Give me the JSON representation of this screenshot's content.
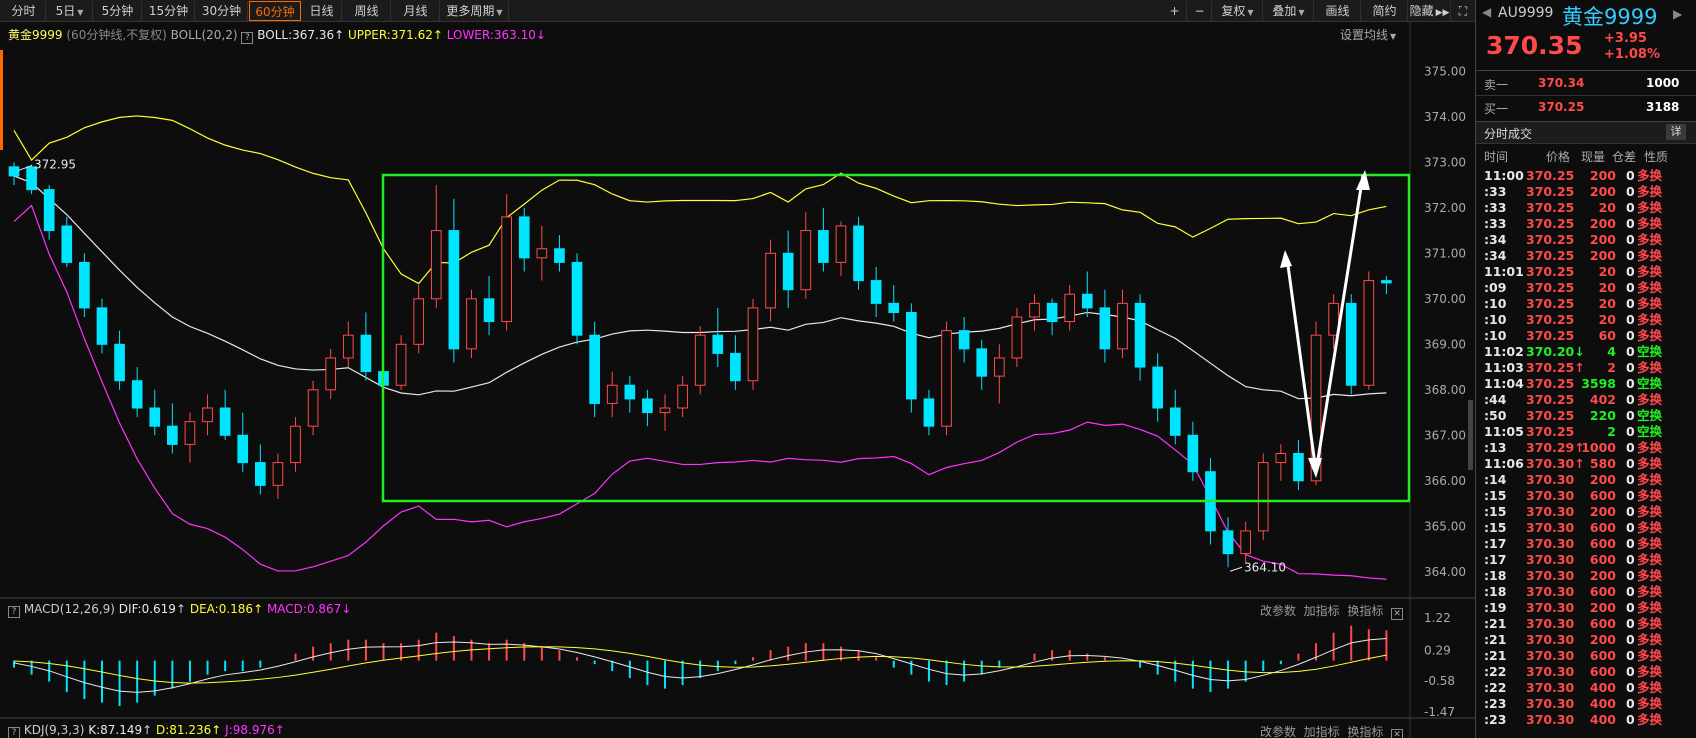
{
  "toolbar": {
    "periods": [
      "分时",
      "5日",
      "5分钟",
      "15分钟",
      "30分钟",
      "60分钟",
      "日线",
      "周线",
      "月线",
      "更多周期"
    ],
    "active_period": "60分钟",
    "right": {
      "plus": "+",
      "minus": "−",
      "fuquan": "复权",
      "diejia": "叠加",
      "huaxian": "画线",
      "jianyue": "简约",
      "yincang": "隐藏",
      "expand": "⛶"
    }
  },
  "main_legend": {
    "symbol": "黄金9999",
    "period_note": "(60分钟线,不复权)",
    "indicator": "BOLL(20,2)",
    "boll": "BOLL:367.36",
    "upper": "UPPER:371.62",
    "lower": "LOWER:363.10",
    "settings": "设置均线"
  },
  "macd_legend": {
    "name": "MACD(12,26,9)",
    "dif": "DIF:0.619",
    "dea": "DEA:0.186",
    "macd": "MACD:0.867",
    "btn1": "改参数",
    "btn2": "加指标",
    "btn3": "换指标"
  },
  "kdj_legend": {
    "name": "KDJ(9,3,3)",
    "k": "K:87.149",
    "d": "D:81.236",
    "j": "J:98.976",
    "btn1": "改参数",
    "btn2": "加指标",
    "btn3": "换指标"
  },
  "price_axis": [
    "375.00",
    "374.00",
    "373.00",
    "372.00",
    "371.00",
    "370.00",
    "369.00",
    "368.00",
    "367.00",
    "366.00",
    "365.00",
    "364.00"
  ],
  "macd_axis": [
    "1.22",
    "0.29",
    "-0.58",
    "-1.47"
  ],
  "annotations": {
    "high": "372.95",
    "low": "364.10"
  },
  "colors": {
    "up": "#ff4a4a",
    "down": "#00e5ff",
    "boll": "#e8e8e8",
    "upper": "#ffff33",
    "lower": "#ff33ff",
    "box": "#22ee22",
    "accent": "#ff6a00"
  },
  "quote": {
    "code": "AU9999",
    "name": "黄金9999",
    "price": "370.35",
    "change": "+3.95",
    "change_pct": "+1.08%",
    "sell_label": "卖一",
    "sell_price": "370.34",
    "sell_vol": "1000",
    "buy_label": "买一",
    "buy_price": "370.25",
    "buy_vol": "3188",
    "section": "分时成交",
    "detail": "详",
    "headers": [
      "时间",
      "价格",
      "现量",
      "仓差",
      "性质"
    ]
  },
  "ticks": [
    {
      "t": "11:00",
      "p": "370.25",
      "v": "200",
      "c": "0",
      "n": "多换",
      "s": "up"
    },
    {
      "t": ":33",
      "p": "370.25",
      "v": "200",
      "c": "0",
      "n": "多换",
      "s": "up"
    },
    {
      "t": ":33",
      "p": "370.25",
      "v": "20",
      "c": "0",
      "n": "多换",
      "s": "up"
    },
    {
      "t": ":33",
      "p": "370.25",
      "v": "200",
      "c": "0",
      "n": "多换",
      "s": "up"
    },
    {
      "t": ":34",
      "p": "370.25",
      "v": "200",
      "c": "0",
      "n": "多换",
      "s": "up"
    },
    {
      "t": ":34",
      "p": "370.25",
      "v": "200",
      "c": "0",
      "n": "多换",
      "s": "up"
    },
    {
      "t": "11:01",
      "p": "370.25",
      "v": "20",
      "c": "0",
      "n": "多换",
      "s": "up"
    },
    {
      "t": ":09",
      "p": "370.25",
      "v": "20",
      "c": "0",
      "n": "多换",
      "s": "up"
    },
    {
      "t": ":10",
      "p": "370.25",
      "v": "20",
      "c": "0",
      "n": "多换",
      "s": "up"
    },
    {
      "t": ":10",
      "p": "370.25",
      "v": "20",
      "c": "0",
      "n": "多换",
      "s": "up"
    },
    {
      "t": ":10",
      "p": "370.25",
      "v": "60",
      "c": "0",
      "n": "多换",
      "s": "up"
    },
    {
      "t": "11:02",
      "p": "370.20↓",
      "v": "4",
      "c": "0",
      "n": "空换",
      "s": "down"
    },
    {
      "t": "11:03",
      "p": "370.25↑",
      "v": "2",
      "c": "0",
      "n": "多换",
      "s": "up"
    },
    {
      "t": "11:04",
      "p": "370.25",
      "v": "3598",
      "c": "0",
      "n": "空换",
      "s": "down"
    },
    {
      "t": ":44",
      "p": "370.25",
      "v": "402",
      "c": "0",
      "n": "多换",
      "s": "up"
    },
    {
      "t": ":50",
      "p": "370.25",
      "v": "220",
      "c": "0",
      "n": "空换",
      "s": "down"
    },
    {
      "t": "11:05",
      "p": "370.25",
      "v": "2",
      "c": "0",
      "n": "空换",
      "s": "down"
    },
    {
      "t": ":13",
      "p": "370.29↑",
      "v": "1000",
      "c": "0",
      "n": "多换",
      "s": "up"
    },
    {
      "t": "11:06",
      "p": "370.30↑",
      "v": "580",
      "c": "0",
      "n": "多换",
      "s": "up"
    },
    {
      "t": ":14",
      "p": "370.30",
      "v": "200",
      "c": "0",
      "n": "多换",
      "s": "up"
    },
    {
      "t": ":15",
      "p": "370.30",
      "v": "600",
      "c": "0",
      "n": "多换",
      "s": "up"
    },
    {
      "t": ":15",
      "p": "370.30",
      "v": "200",
      "c": "0",
      "n": "多换",
      "s": "up"
    },
    {
      "t": ":15",
      "p": "370.30",
      "v": "600",
      "c": "0",
      "n": "多换",
      "s": "up"
    },
    {
      "t": ":17",
      "p": "370.30",
      "v": "600",
      "c": "0",
      "n": "多换",
      "s": "up"
    },
    {
      "t": ":17",
      "p": "370.30",
      "v": "600",
      "c": "0",
      "n": "多换",
      "s": "up"
    },
    {
      "t": ":18",
      "p": "370.30",
      "v": "200",
      "c": "0",
      "n": "多换",
      "s": "up"
    },
    {
      "t": ":18",
      "p": "370.30",
      "v": "600",
      "c": "0",
      "n": "多换",
      "s": "up"
    },
    {
      "t": ":19",
      "p": "370.30",
      "v": "200",
      "c": "0",
      "n": "多换",
      "s": "up"
    },
    {
      "t": ":21",
      "p": "370.30",
      "v": "600",
      "c": "0",
      "n": "多换",
      "s": "up"
    },
    {
      "t": ":21",
      "p": "370.30",
      "v": "200",
      "c": "0",
      "n": "多换",
      "s": "up"
    },
    {
      "t": ":21",
      "p": "370.30",
      "v": "600",
      "c": "0",
      "n": "多换",
      "s": "up"
    },
    {
      "t": ":22",
      "p": "370.30",
      "v": "600",
      "c": "0",
      "n": "多换",
      "s": "up"
    },
    {
      "t": ":22",
      "p": "370.30",
      "v": "400",
      "c": "0",
      "n": "多换",
      "s": "up"
    },
    {
      "t": ":23",
      "p": "370.30",
      "v": "400",
      "c": "0",
      "n": "多换",
      "s": "up"
    },
    {
      "t": ":23",
      "p": "370.30",
      "v": "400",
      "c": "0",
      "n": "多换",
      "s": "up"
    }
  ],
  "chart_data": {
    "type": "candlestick",
    "price_range": [
      363.6,
      375.6
    ],
    "candles": [
      {
        "o": 372.9,
        "h": 373.0,
        "l": 372.5,
        "c": 372.7
      },
      {
        "o": 372.9,
        "h": 372.95,
        "l": 372.3,
        "c": 372.4
      },
      {
        "o": 372.4,
        "h": 372.5,
        "l": 371.3,
        "c": 371.5
      },
      {
        "o": 371.6,
        "h": 371.8,
        "l": 370.7,
        "c": 370.8
      },
      {
        "o": 370.8,
        "h": 371.0,
        "l": 369.6,
        "c": 369.8
      },
      {
        "o": 369.8,
        "h": 370.0,
        "l": 368.8,
        "c": 369.0
      },
      {
        "o": 369.0,
        "h": 369.3,
        "l": 368.0,
        "c": 368.2
      },
      {
        "o": 368.2,
        "h": 368.5,
        "l": 367.4,
        "c": 367.6
      },
      {
        "o": 367.6,
        "h": 368.0,
        "l": 367.0,
        "c": 367.2
      },
      {
        "o": 367.2,
        "h": 367.7,
        "l": 366.6,
        "c": 366.8
      },
      {
        "o": 366.8,
        "h": 367.5,
        "l": 366.4,
        "c": 367.3
      },
      {
        "o": 367.3,
        "h": 367.9,
        "l": 367.0,
        "c": 367.6
      },
      {
        "o": 367.6,
        "h": 368.0,
        "l": 366.9,
        "c": 367.0
      },
      {
        "o": 367.0,
        "h": 367.5,
        "l": 366.2,
        "c": 366.4
      },
      {
        "o": 366.4,
        "h": 366.8,
        "l": 365.7,
        "c": 365.9
      },
      {
        "o": 365.9,
        "h": 366.6,
        "l": 365.6,
        "c": 366.4
      },
      {
        "o": 366.4,
        "h": 367.4,
        "l": 366.2,
        "c": 367.2
      },
      {
        "o": 367.2,
        "h": 368.2,
        "l": 367.0,
        "c": 368.0
      },
      {
        "o": 368.0,
        "h": 368.9,
        "l": 367.8,
        "c": 368.7
      },
      {
        "o": 368.7,
        "h": 369.5,
        "l": 368.5,
        "c": 369.2
      },
      {
        "o": 369.2,
        "h": 369.7,
        "l": 368.2,
        "c": 368.4
      },
      {
        "o": 368.4,
        "h": 368.6,
        "l": 367.9,
        "c": 368.1
      },
      {
        "o": 368.1,
        "h": 369.2,
        "l": 368.0,
        "c": 369.0
      },
      {
        "o": 369.0,
        "h": 370.3,
        "l": 368.8,
        "c": 370.0
      },
      {
        "o": 370.0,
        "h": 372.5,
        "l": 369.8,
        "c": 371.5
      },
      {
        "o": 371.5,
        "h": 372.2,
        "l": 368.6,
        "c": 368.9
      },
      {
        "o": 368.9,
        "h": 370.2,
        "l": 368.7,
        "c": 370.0
      },
      {
        "o": 370.0,
        "h": 370.5,
        "l": 369.2,
        "c": 369.5
      },
      {
        "o": 369.5,
        "h": 372.3,
        "l": 369.3,
        "c": 371.8
      },
      {
        "o": 371.8,
        "h": 372.0,
        "l": 370.6,
        "c": 370.9
      },
      {
        "o": 370.9,
        "h": 371.6,
        "l": 370.4,
        "c": 371.1
      },
      {
        "o": 371.1,
        "h": 371.4,
        "l": 370.6,
        "c": 370.8
      },
      {
        "o": 370.8,
        "h": 371.0,
        "l": 369.0,
        "c": 369.2
      },
      {
        "o": 369.2,
        "h": 369.5,
        "l": 367.4,
        "c": 367.7
      },
      {
        "o": 367.7,
        "h": 368.4,
        "l": 367.4,
        "c": 368.1
      },
      {
        "o": 368.1,
        "h": 368.3,
        "l": 367.5,
        "c": 367.8
      },
      {
        "o": 367.8,
        "h": 368.0,
        "l": 367.2,
        "c": 367.5
      },
      {
        "o": 367.5,
        "h": 367.9,
        "l": 367.1,
        "c": 367.6
      },
      {
        "o": 367.6,
        "h": 368.3,
        "l": 367.4,
        "c": 368.1
      },
      {
        "o": 368.1,
        "h": 369.4,
        "l": 367.9,
        "c": 369.2
      },
      {
        "o": 369.2,
        "h": 369.8,
        "l": 368.5,
        "c": 368.8
      },
      {
        "o": 368.8,
        "h": 369.2,
        "l": 368.0,
        "c": 368.2
      },
      {
        "o": 368.2,
        "h": 370.0,
        "l": 368.0,
        "c": 369.8
      },
      {
        "o": 369.8,
        "h": 371.3,
        "l": 369.5,
        "c": 371.0
      },
      {
        "o": 371.0,
        "h": 371.5,
        "l": 369.8,
        "c": 370.2
      },
      {
        "o": 370.2,
        "h": 371.9,
        "l": 370.0,
        "c": 371.5
      },
      {
        "o": 371.5,
        "h": 372.0,
        "l": 370.6,
        "c": 370.8
      },
      {
        "o": 370.8,
        "h": 371.7,
        "l": 370.5,
        "c": 371.6
      },
      {
        "o": 371.6,
        "h": 371.8,
        "l": 370.2,
        "c": 370.4
      },
      {
        "o": 370.4,
        "h": 370.7,
        "l": 369.6,
        "c": 369.9
      },
      {
        "o": 369.9,
        "h": 370.3,
        "l": 369.5,
        "c": 369.7
      },
      {
        "o": 369.7,
        "h": 369.9,
        "l": 367.5,
        "c": 367.8
      },
      {
        "o": 367.8,
        "h": 368.0,
        "l": 367.0,
        "c": 367.2
      },
      {
        "o": 367.2,
        "h": 369.5,
        "l": 367.0,
        "c": 369.3
      },
      {
        "o": 369.3,
        "h": 369.6,
        "l": 368.6,
        "c": 368.9
      },
      {
        "o": 368.9,
        "h": 369.1,
        "l": 368.0,
        "c": 368.3
      },
      {
        "o": 368.3,
        "h": 369.0,
        "l": 367.7,
        "c": 368.7
      },
      {
        "o": 368.7,
        "h": 369.8,
        "l": 368.5,
        "c": 369.6
      },
      {
        "o": 369.6,
        "h": 370.1,
        "l": 369.3,
        "c": 369.9
      },
      {
        "o": 369.9,
        "h": 370.0,
        "l": 369.2,
        "c": 369.5
      },
      {
        "o": 369.5,
        "h": 370.3,
        "l": 369.3,
        "c": 370.1
      },
      {
        "o": 370.1,
        "h": 370.6,
        "l": 369.6,
        "c": 369.8
      },
      {
        "o": 369.8,
        "h": 370.2,
        "l": 368.6,
        "c": 368.9
      },
      {
        "o": 368.9,
        "h": 370.2,
        "l": 368.7,
        "c": 369.9
      },
      {
        "o": 369.9,
        "h": 370.1,
        "l": 368.2,
        "c": 368.5
      },
      {
        "o": 368.5,
        "h": 368.8,
        "l": 367.3,
        "c": 367.6
      },
      {
        "o": 367.6,
        "h": 368.0,
        "l": 366.8,
        "c": 367.0
      },
      {
        "o": 367.0,
        "h": 367.3,
        "l": 366.0,
        "c": 366.2
      },
      {
        "o": 366.2,
        "h": 366.5,
        "l": 364.6,
        "c": 364.9
      },
      {
        "o": 364.9,
        "h": 365.2,
        "l": 364.1,
        "c": 364.4
      },
      {
        "o": 364.4,
        "h": 365.1,
        "l": 364.2,
        "c": 364.9
      },
      {
        "o": 364.9,
        "h": 366.6,
        "l": 364.7,
        "c": 366.4
      },
      {
        "o": 366.4,
        "h": 366.8,
        "l": 366.0,
        "c": 366.6
      },
      {
        "o": 366.6,
        "h": 366.9,
        "l": 365.8,
        "c": 366.0
      },
      {
        "o": 366.0,
        "h": 369.5,
        "l": 365.9,
        "c": 369.2
      },
      {
        "o": 369.2,
        "h": 370.1,
        "l": 368.9,
        "c": 369.9
      },
      {
        "o": 369.9,
        "h": 370.1,
        "l": 367.9,
        "c": 368.1
      },
      {
        "o": 368.1,
        "h": 370.6,
        "l": 368.0,
        "c": 370.4
      },
      {
        "o": 370.4,
        "h": 370.5,
        "l": 370.1,
        "c": 370.35
      }
    ],
    "macd": [
      -0.2,
      -0.4,
      -0.6,
      -0.9,
      -1.1,
      -1.2,
      -1.3,
      -1.2,
      -1.0,
      -0.8,
      -0.6,
      -0.4,
      -0.3,
      -0.3,
      -0.2,
      0.0,
      0.2,
      0.4,
      0.5,
      0.6,
      0.6,
      0.5,
      0.5,
      0.6,
      0.8,
      0.7,
      0.6,
      0.5,
      0.6,
      0.5,
      0.4,
      0.3,
      0.1,
      -0.1,
      -0.3,
      -0.5,
      -0.7,
      -0.8,
      -0.7,
      -0.5,
      -0.3,
      -0.1,
      0.1,
      0.3,
      0.4,
      0.5,
      0.5,
      0.4,
      0.3,
      0.1,
      -0.2,
      -0.4,
      -0.6,
      -0.7,
      -0.6,
      -0.4,
      -0.2,
      0.0,
      0.2,
      0.3,
      0.3,
      0.2,
      0.1,
      0.0,
      -0.2,
      -0.4,
      -0.6,
      -0.8,
      -0.9,
      -0.8,
      -0.6,
      -0.3,
      -0.1,
      0.2,
      0.5,
      0.8,
      1.0,
      0.9,
      0.867
    ]
  }
}
